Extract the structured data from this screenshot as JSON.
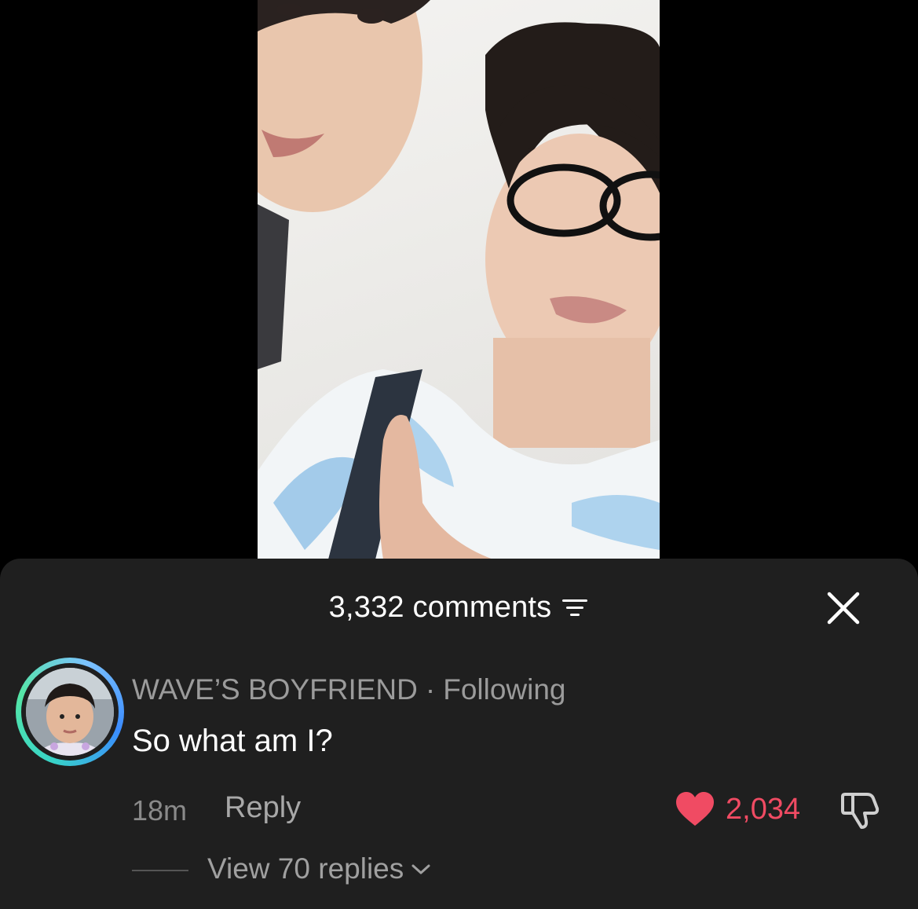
{
  "comments_sheet": {
    "count_label": "3,332 comments",
    "filter_icon": "filter-icon",
    "close_icon": "close-icon"
  },
  "comment": {
    "author": "WAVE’S BOYFRIEND",
    "separator": "·",
    "relation": "Following",
    "text": "So what am I?",
    "time": "18m",
    "reply_label": "Reply",
    "likes": "2,034",
    "like_color": "#f04b63",
    "view_replies_label": "View 70 replies"
  },
  "colors": {
    "sheet_bg": "#1f1f1f",
    "avatar_ring": "#38d4c7"
  }
}
